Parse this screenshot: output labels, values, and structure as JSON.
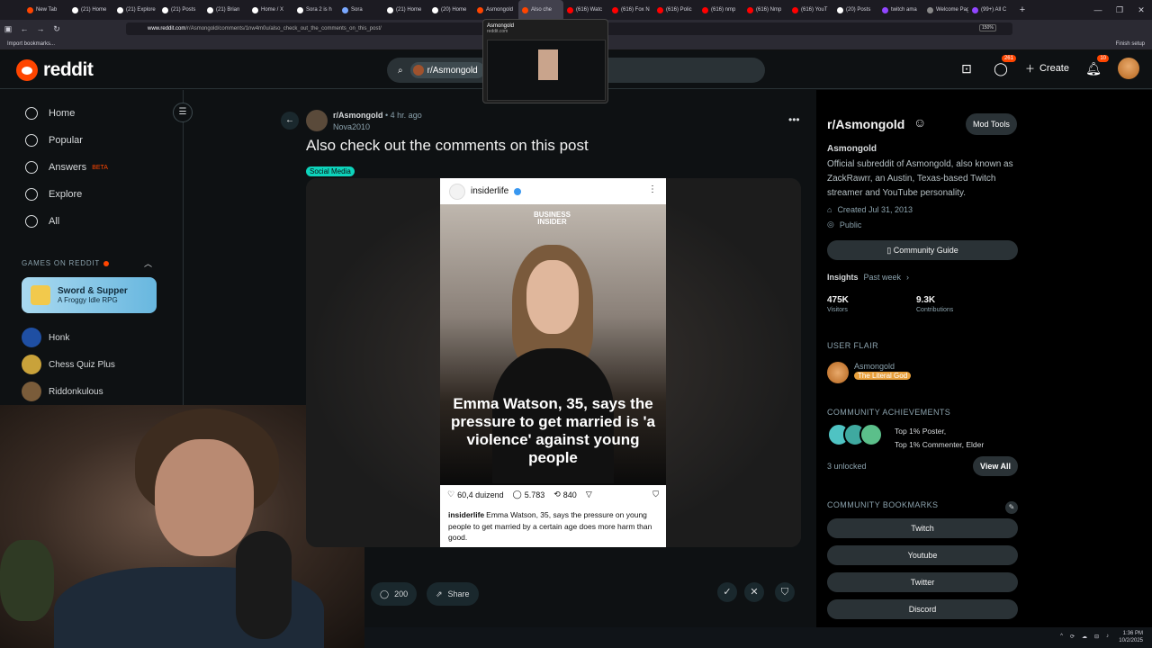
{
  "browser": {
    "tabs": [
      {
        "label": "New Tab",
        "color": "#ff4500"
      },
      {
        "label": "(21) Home",
        "color": "#ffffff"
      },
      {
        "label": "(21) Explore",
        "color": "#ffffff"
      },
      {
        "label": "(21) Posts",
        "color": "#ffffff"
      },
      {
        "label": "(21) Brian",
        "color": "#ffffff"
      },
      {
        "label": "Home / X",
        "color": "#ffffff"
      },
      {
        "label": "Sora 2 is h",
        "color": "#ffffff"
      },
      {
        "label": "Sora",
        "color": "#7aa8ff"
      },
      {
        "label": "(21) Home",
        "color": "#ffffff"
      },
      {
        "label": "(20) Home",
        "color": "#ffffff"
      },
      {
        "label": "Asmongold",
        "color": "#ff4500"
      },
      {
        "label": "Also che",
        "color": "#ff4500"
      },
      {
        "label": "(616) Watc",
        "color": "#ff0000"
      },
      {
        "label": "(616) Fox N",
        "color": "#ff0000"
      },
      {
        "label": "(616) Polic",
        "color": "#ff0000"
      },
      {
        "label": "(616) nmp",
        "color": "#ff0000"
      },
      {
        "label": "(616) Nmp",
        "color": "#ff0000"
      },
      {
        "label": "(616) YouT",
        "color": "#ff0000"
      },
      {
        "label": "(20) Posts",
        "color": "#ffffff"
      },
      {
        "label": "twitch ama",
        "color": "#9146ff"
      },
      {
        "label": "Welcome Page",
        "color": "#888888"
      },
      {
        "label": "(99+) All C",
        "color": "#9146ff"
      }
    ],
    "active_tab_index": 11,
    "url_domain": "www.reddit.com",
    "url_path": "/r/Asmongold/comments/1nw4m0u/also_check_out_the_comments_on_this_post/",
    "zoom": "150%",
    "import_bookmarks": "Import bookmarks...",
    "finish_setup": "Finish setup",
    "tab_preview": {
      "title": "Asmongold",
      "url": "reddit.com"
    }
  },
  "header": {
    "logo_text": "reddit",
    "search_chip": "r/Asmongold",
    "chat_badge": "261",
    "create_label": "Create",
    "notif_badge": "10"
  },
  "leftnav": {
    "items": [
      {
        "label": "Home",
        "icon": "home-icon"
      },
      {
        "label": "Popular",
        "icon": "popular-icon"
      },
      {
        "label": "Answers",
        "icon": "answers-icon",
        "badge": "BETA"
      },
      {
        "label": "Explore",
        "icon": "explore-icon"
      },
      {
        "label": "All",
        "icon": "all-icon"
      }
    ],
    "games_header": "GAMES ON REDDIT",
    "promo": {
      "title": "Sword & Supper",
      "subtitle": "A Froggy Idle RPG"
    },
    "games": [
      {
        "label": "Honk",
        "color": "#1f4fa3"
      },
      {
        "label": "Chess Quiz Plus",
        "color": "#c9a23a"
      },
      {
        "label": "Riddonkulous",
        "color": "#7a5c3a"
      }
    ]
  },
  "post": {
    "subreddit": "r/Asmongold",
    "time": "4 hr. ago",
    "user": "Nova2010",
    "title": "Also check out the comments on this post",
    "flair": "Social Media",
    "ig": {
      "account": "insiderlife",
      "brand_line1": "BUSINESS",
      "brand_line2": "INSIDER",
      "headline": "Emma Watson, 35, says the pressure to get married is 'a violence' against young people",
      "likes": "60,4 duizend",
      "comments": "5.783",
      "reposts": "840",
      "caption_user": "insiderlife",
      "caption": "Emma Watson, 35, says the pressure on young people to get married by a certain age does more harm than good."
    },
    "comments_count": "200",
    "share_label": "Share"
  },
  "sidebar": {
    "title": "r/Asmongold",
    "mod_tools": "Mod Tools",
    "name": "Asmongold",
    "description": "Official subreddit of Asmongold, also known as ZackRawrr, an Austin, Texas-based Twitch streamer and YouTube personality.",
    "created": "Created Jul 31, 2013",
    "visibility": "Public",
    "community_guide": "Community Guide",
    "insights_label": "Insights",
    "insights_range": "Past week",
    "visitors_value": "475K",
    "visitors_label": "Visitors",
    "contributions_value": "9.3K",
    "contributions_label": "Contributions",
    "user_flair_label": "USER FLAIR",
    "flair_user": "Asmongold",
    "flair_tag": "The Literal God",
    "achievements_label": "COMMUNITY ACHIEVEMENTS",
    "achievements_line1": "Top 1% Poster,",
    "achievements_line2": "Top 1% Commenter, Elder",
    "unlocked": "3 unlocked",
    "view_all": "View All",
    "bookmarks_label": "COMMUNITY BOOKMARKS",
    "bookmarks": [
      "Twitch",
      "Youtube",
      "Twitter",
      "Discord"
    ]
  },
  "taskbar": {
    "time": "1:36 PM",
    "date": "10/2/2025"
  }
}
